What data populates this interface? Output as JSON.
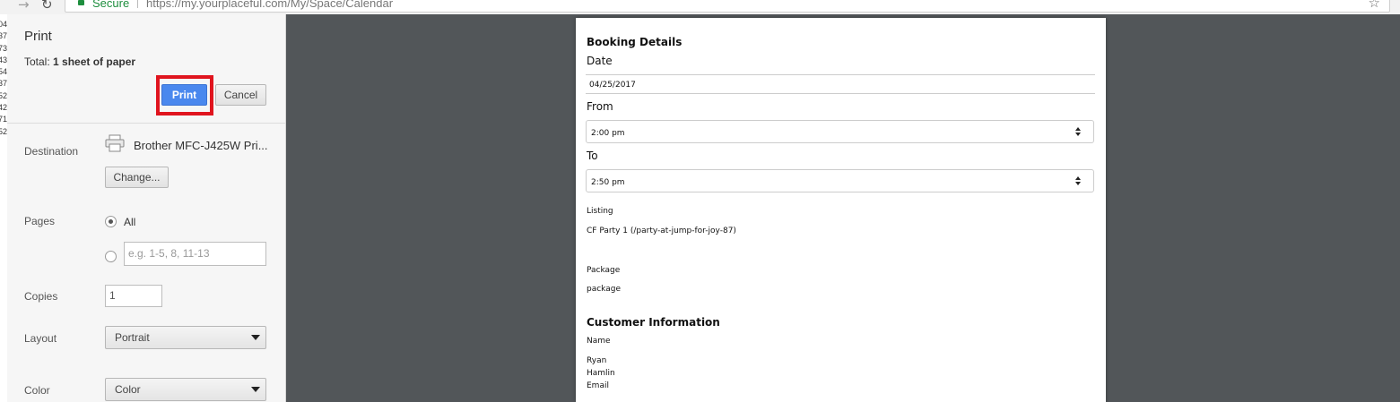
{
  "browser": {
    "secure_label": "Secure",
    "url": "https://my.yourplaceful.com/My/Space/Calendar",
    "star_icon": "star-icon",
    "forward_icon": "forward-arrow-icon",
    "reload_icon": "reload-icon"
  },
  "underlying_page": {
    "fragments": [
      "04",
      "37",
      "73",
      "43",
      "54",
      "37",
      "52",
      "42",
      "71",
      "52"
    ]
  },
  "print_dialog": {
    "title": "Print",
    "total_prefix": "Total: ",
    "total_value": "1 sheet of paper",
    "print_button": "Print",
    "cancel_button": "Cancel",
    "destination_label": "Destination",
    "printer_name": "Brother MFC-J425W Pri...",
    "change_button": "Change...",
    "pages_label": "Pages",
    "pages_all": "All",
    "pages_placeholder": "e.g. 1-5, 8, 11-13",
    "copies_label": "Copies",
    "copies_value": "1",
    "layout_label": "Layout",
    "layout_value": "Portrait",
    "color_label": "Color",
    "color_value": "Color",
    "highlight_color": "#e0141e",
    "print_button_color": "#4a88ee"
  },
  "preview": {
    "booking_heading": "Booking Details",
    "date_label": "Date",
    "date_value": "04/25/2017",
    "from_label": "From",
    "from_value": "2:00 pm",
    "to_label": "To",
    "to_value": "2:50 pm",
    "listing_label": "Listing",
    "listing_value": "CF Party 1 (/party-at-jump-for-joy-87)",
    "package_label": "Package",
    "package_value": "package",
    "customer_heading": "Customer Information",
    "name_label": "Name",
    "first_name": "Ryan",
    "last_name": "Hamlin",
    "email_label": "Email"
  }
}
